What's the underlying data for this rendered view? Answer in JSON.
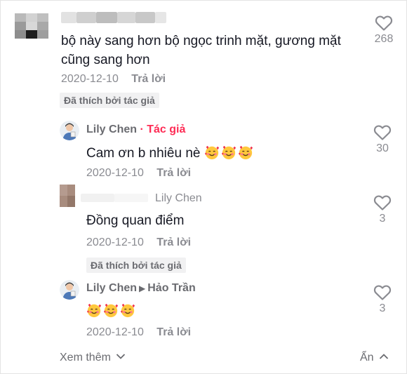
{
  "main_comment": {
    "text": "bộ này sang hơn bộ ngọc trinh mặt, gương mặt cũng sang hơn",
    "date": "2020-12-10",
    "reply_label": "Trả lời",
    "liked_by_author": "Đã thích bởi tác giả",
    "likes": "268"
  },
  "replies": [
    {
      "name": "Lily Chen",
      "tag": "· Tác giả",
      "text": "Cam ơn b nhiêu nè",
      "emoji_count": 3,
      "date": "2020-12-10",
      "reply_label": "Trả lời",
      "likes": "30"
    },
    {
      "name": "Lily Chen",
      "text": "Đồng quan điểm",
      "date": "2020-12-10",
      "reply_label": "Trả lời",
      "liked_by_author": "Đã thích bởi tác giả",
      "likes": "3"
    },
    {
      "name": "Lily Chen",
      "reply_to": "Hảo Trần",
      "emoji_count": 3,
      "date": "2020-12-10",
      "reply_label": "Trả lời",
      "likes": "3"
    }
  ],
  "footer": {
    "view_more": "Xem thêm",
    "hide": "Ẩn"
  },
  "colors": {
    "accent": "#fe2c55",
    "muted": "#8a8b91"
  }
}
